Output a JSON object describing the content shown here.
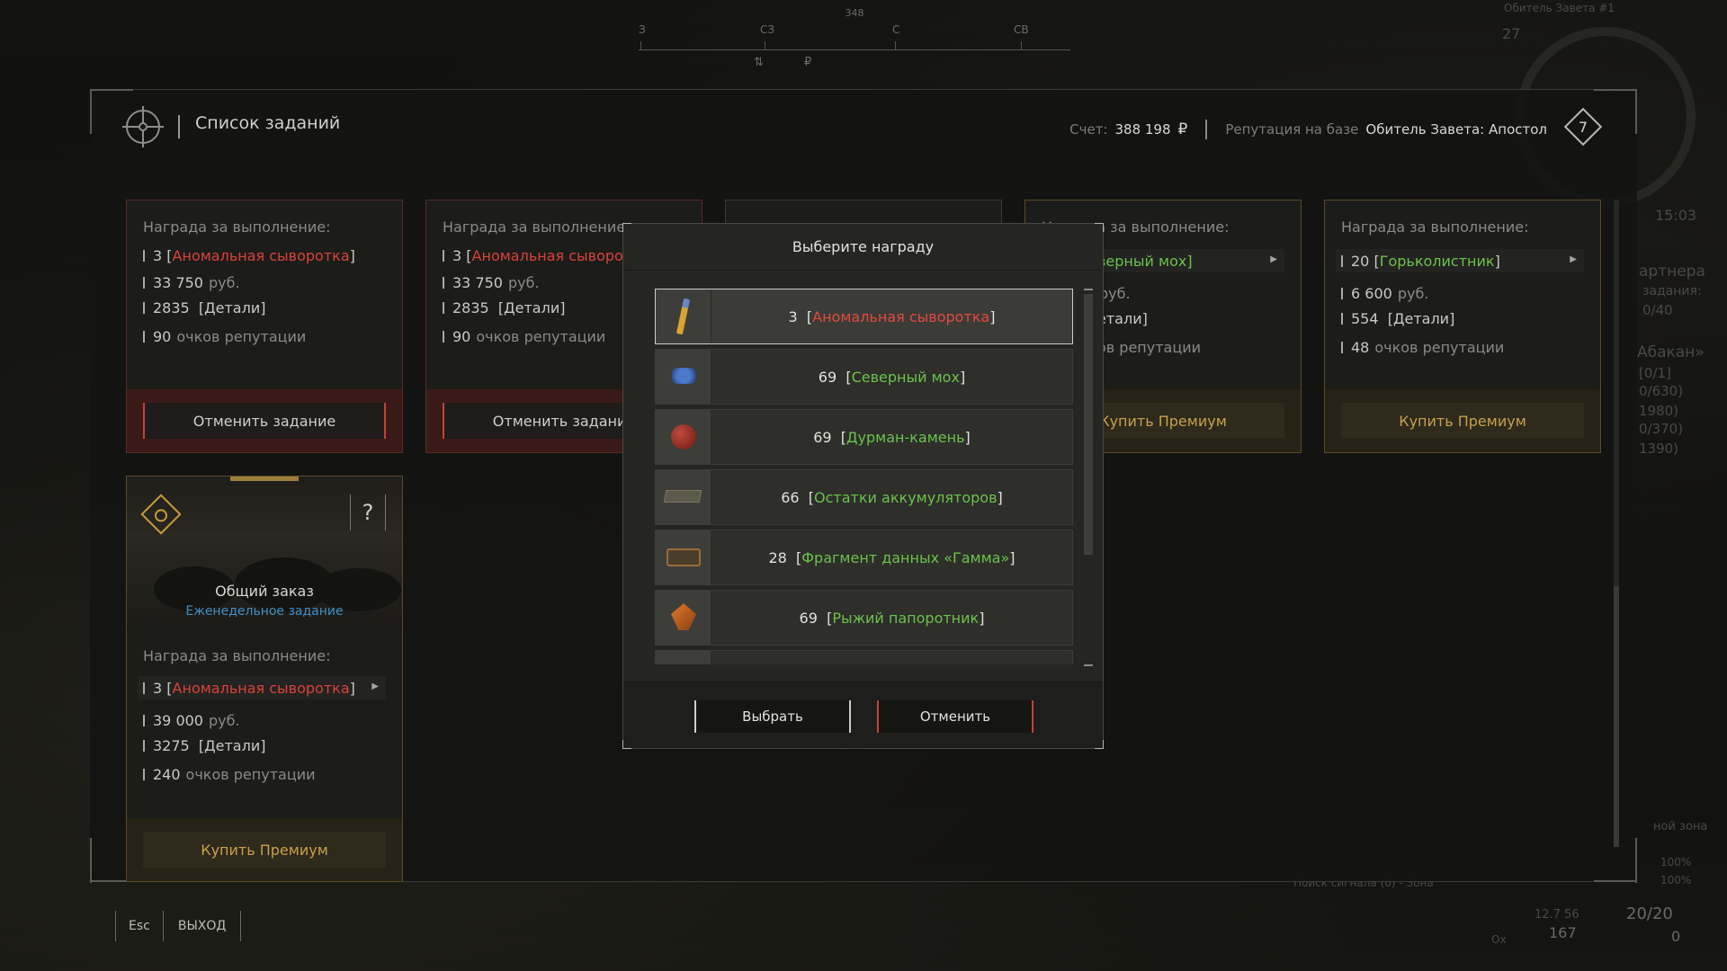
{
  "compass": {
    "heading": "348",
    "marks": [
      "З",
      "СЗ",
      "С",
      "СВ"
    ],
    "sub1": "⇅",
    "sub2": "₽"
  },
  "hud": {
    "top_right_label": "Обитель Завета #1",
    "top_right_num": "27",
    "time": "15:03",
    "partner_title": "артнера",
    "partner_sub": "задания:",
    "partner_count": "0/40",
    "region": "Абакан»",
    "stats": [
      "[0/1]",
      "0/630)",
      "1980)",
      "0/370)",
      "1390)"
    ],
    "zone": "ной зона",
    "pct1": "100%",
    "pct2": "100%",
    "signal": "Поиск сигнала (0) - Зона",
    "coords": "12.7 56",
    "num167": "167",
    "ammo": "20/20",
    "zero": "0",
    "ox": "Ox"
  },
  "header": {
    "title": "Список заданий",
    "account_label": "Счет:",
    "account_value": "388 198",
    "currency": "₽",
    "rep_label": "Репутация на базе",
    "rep_value": "Обитель Завета: Апостол",
    "rep_level": "7"
  },
  "cards": [
    {
      "reward_label": "Награда за выполнение:",
      "item_qty": "3",
      "item_name": "Аномальная сыворотка",
      "money": "33 750",
      "money_unit": "руб.",
      "parts": "2835",
      "parts_label": "Детали",
      "rep": "90",
      "rep_label": "очков репутации",
      "button": "Отменить задание"
    },
    {
      "reward_label": "Награда за выполнение:",
      "item_qty": "3",
      "item_name": "Аномальная сыворотк",
      "money": "33 750",
      "money_unit": "руб.",
      "parts": "2835",
      "parts_label": "Детали",
      "rep": "90",
      "rep_label": "очков репутации",
      "button": "Отменить задание"
    },
    {
      "reward_label": "Награда за выполнение:",
      "item_name_partial": "верный мох]",
      "money_unit": "руб.",
      "parts_partial": "етали]",
      "rep_partial": "ов репутации",
      "button": "Купить Премиум"
    },
    {
      "reward_label": "Награда за выполнение:",
      "item_qty": "20",
      "item_name": "Горьколистник",
      "money": "6 600",
      "money_unit": "руб.",
      "parts": "554",
      "parts_label": "Детали",
      "rep": "48",
      "rep_label": "очков репутации",
      "button": "Купить Премиум"
    }
  ],
  "special_card": {
    "title": "Общий заказ",
    "subtitle": "Еженедельное задание",
    "help": "?",
    "reward_label": "Награда за выполнение:",
    "item_qty": "3",
    "item_name": "Аномальная сыворотка",
    "money": "39 000",
    "money_unit": "руб.",
    "parts": "3275",
    "parts_label": "Детали",
    "rep": "240",
    "rep_label": "очков репутации",
    "button": "Купить Премиум"
  },
  "modal": {
    "title": "Выберите награду",
    "options": [
      {
        "qty": "3",
        "name": "Аномальная сыворотка",
        "color": "red",
        "icon": "serum-icon"
      },
      {
        "qty": "69",
        "name": "Северный мох",
        "color": "green",
        "icon": "moss-icon"
      },
      {
        "qty": "69",
        "name": "Дурман-камень",
        "color": "green",
        "icon": "stone-icon"
      },
      {
        "qty": "66",
        "name": "Остатки аккумуляторов",
        "color": "green",
        "icon": "battery-icon"
      },
      {
        "qty": "28",
        "name": "Фрагмент данных «Гамма»",
        "color": "green",
        "icon": "data-fragment-icon"
      },
      {
        "qty": "69",
        "name": "Рыжий папоротник",
        "color": "green",
        "icon": "fern-icon"
      }
    ],
    "select_label": "Выбрать",
    "cancel_label": "Отменить"
  },
  "footer": {
    "esc": "Esc",
    "exit": "ВЫХОД"
  },
  "colors": {
    "red_text": "#e24a3e",
    "green_text": "#6bc24a",
    "gold_text": "#c8a04a",
    "blue_text": "#3f8fc6"
  }
}
